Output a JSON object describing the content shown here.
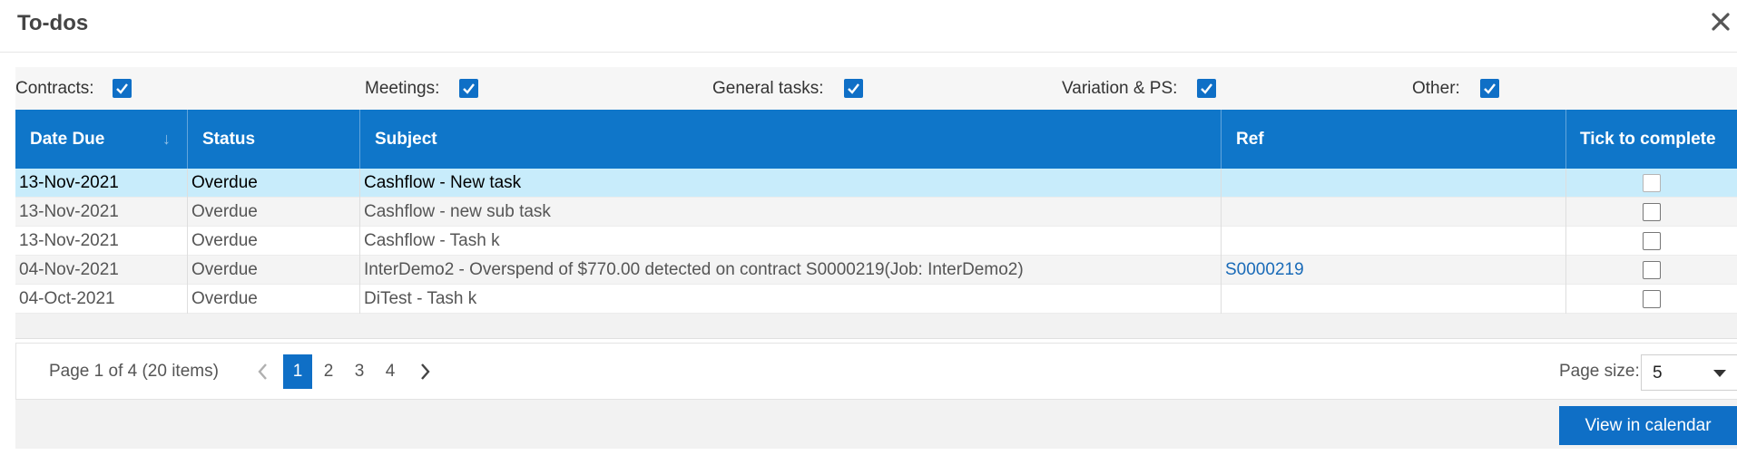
{
  "dialog": {
    "title": "To-dos"
  },
  "filters": [
    {
      "label": "Contracts:",
      "checked": true
    },
    {
      "label": "Meetings:",
      "checked": true
    },
    {
      "label": "General tasks:",
      "checked": true
    },
    {
      "label": "Variation & PS:",
      "checked": true
    },
    {
      "label": "Other:",
      "checked": true
    }
  ],
  "grid": {
    "columns": [
      "Date Due",
      "Status",
      "Subject",
      "Ref",
      "Tick to complete"
    ],
    "rows": [
      {
        "date_due": "13-Nov-2021",
        "status": "Overdue",
        "subject": "Cashflow - New task",
        "ref": "",
        "completed": false
      },
      {
        "date_due": "13-Nov-2021",
        "status": "Overdue",
        "subject": "Cashflow - new sub task",
        "ref": "",
        "completed": false
      },
      {
        "date_due": "13-Nov-2021",
        "status": "Overdue",
        "subject": "Cashflow - Tash k",
        "ref": "",
        "completed": false
      },
      {
        "date_due": "04-Nov-2021",
        "status": "Overdue",
        "subject": "InterDemo2 - Overspend of $770.00 detected on contract S0000219(Job: InterDemo2)",
        "ref": "S0000219",
        "completed": false
      },
      {
        "date_due": "04-Oct-2021",
        "status": "Overdue",
        "subject": "DiTest - Tash k",
        "ref": "",
        "completed": false
      }
    ]
  },
  "pager": {
    "info": "Page 1 of 4 (20 items)",
    "pages": [
      "1",
      "2",
      "3",
      "4"
    ],
    "current_page": "1",
    "page_size_label": "Page size:",
    "page_size": "5"
  },
  "footer": {
    "view_calendar_label": "View in calendar"
  },
  "colors": {
    "header_blue": "#0f76c9",
    "accent": "#0f6fc6",
    "selected_row": "#c8ecfb",
    "link": "#1a6bb8"
  }
}
